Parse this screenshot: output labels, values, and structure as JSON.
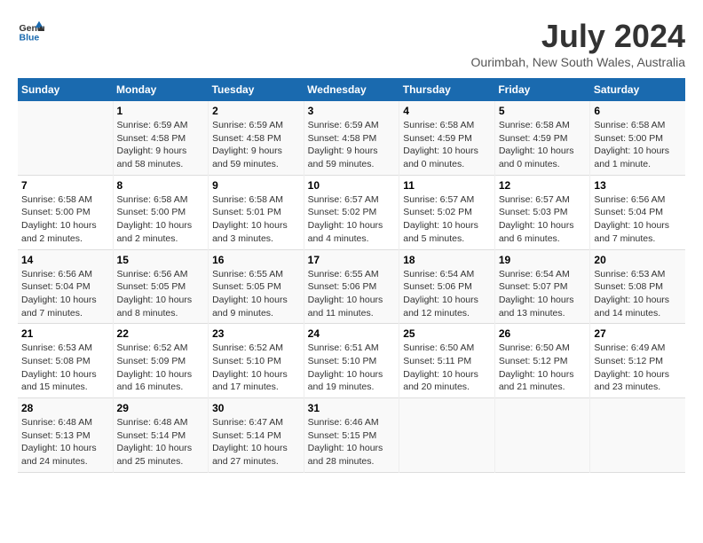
{
  "header": {
    "logo_general": "General",
    "logo_blue": "Blue",
    "title": "July 2024",
    "subtitle": "Ourimbah, New South Wales, Australia"
  },
  "columns": [
    "Sunday",
    "Monday",
    "Tuesday",
    "Wednesday",
    "Thursday",
    "Friday",
    "Saturday"
  ],
  "weeks": [
    [
      {
        "day": "",
        "info": ""
      },
      {
        "day": "1",
        "info": "Sunrise: 6:59 AM\nSunset: 4:58 PM\nDaylight: 9 hours\nand 58 minutes."
      },
      {
        "day": "2",
        "info": "Sunrise: 6:59 AM\nSunset: 4:58 PM\nDaylight: 9 hours\nand 59 minutes."
      },
      {
        "day": "3",
        "info": "Sunrise: 6:59 AM\nSunset: 4:58 PM\nDaylight: 9 hours\nand 59 minutes."
      },
      {
        "day": "4",
        "info": "Sunrise: 6:58 AM\nSunset: 4:59 PM\nDaylight: 10 hours\nand 0 minutes."
      },
      {
        "day": "5",
        "info": "Sunrise: 6:58 AM\nSunset: 4:59 PM\nDaylight: 10 hours\nand 0 minutes."
      },
      {
        "day": "6",
        "info": "Sunrise: 6:58 AM\nSunset: 5:00 PM\nDaylight: 10 hours\nand 1 minute."
      }
    ],
    [
      {
        "day": "7",
        "info": "Sunrise: 6:58 AM\nSunset: 5:00 PM\nDaylight: 10 hours\nand 2 minutes."
      },
      {
        "day": "8",
        "info": "Sunrise: 6:58 AM\nSunset: 5:00 PM\nDaylight: 10 hours\nand 2 minutes."
      },
      {
        "day": "9",
        "info": "Sunrise: 6:58 AM\nSunset: 5:01 PM\nDaylight: 10 hours\nand 3 minutes."
      },
      {
        "day": "10",
        "info": "Sunrise: 6:57 AM\nSunset: 5:02 PM\nDaylight: 10 hours\nand 4 minutes."
      },
      {
        "day": "11",
        "info": "Sunrise: 6:57 AM\nSunset: 5:02 PM\nDaylight: 10 hours\nand 5 minutes."
      },
      {
        "day": "12",
        "info": "Sunrise: 6:57 AM\nSunset: 5:03 PM\nDaylight: 10 hours\nand 6 minutes."
      },
      {
        "day": "13",
        "info": "Sunrise: 6:56 AM\nSunset: 5:04 PM\nDaylight: 10 hours\nand 7 minutes."
      }
    ],
    [
      {
        "day": "14",
        "info": "Sunrise: 6:56 AM\nSunset: 5:04 PM\nDaylight: 10 hours\nand 7 minutes."
      },
      {
        "day": "15",
        "info": "Sunrise: 6:56 AM\nSunset: 5:05 PM\nDaylight: 10 hours\nand 8 minutes."
      },
      {
        "day": "16",
        "info": "Sunrise: 6:55 AM\nSunset: 5:05 PM\nDaylight: 10 hours\nand 9 minutes."
      },
      {
        "day": "17",
        "info": "Sunrise: 6:55 AM\nSunset: 5:06 PM\nDaylight: 10 hours\nand 11 minutes."
      },
      {
        "day": "18",
        "info": "Sunrise: 6:54 AM\nSunset: 5:06 PM\nDaylight: 10 hours\nand 12 minutes."
      },
      {
        "day": "19",
        "info": "Sunrise: 6:54 AM\nSunset: 5:07 PM\nDaylight: 10 hours\nand 13 minutes."
      },
      {
        "day": "20",
        "info": "Sunrise: 6:53 AM\nSunset: 5:08 PM\nDaylight: 10 hours\nand 14 minutes."
      }
    ],
    [
      {
        "day": "21",
        "info": "Sunrise: 6:53 AM\nSunset: 5:08 PM\nDaylight: 10 hours\nand 15 minutes."
      },
      {
        "day": "22",
        "info": "Sunrise: 6:52 AM\nSunset: 5:09 PM\nDaylight: 10 hours\nand 16 minutes."
      },
      {
        "day": "23",
        "info": "Sunrise: 6:52 AM\nSunset: 5:10 PM\nDaylight: 10 hours\nand 17 minutes."
      },
      {
        "day": "24",
        "info": "Sunrise: 6:51 AM\nSunset: 5:10 PM\nDaylight: 10 hours\nand 19 minutes."
      },
      {
        "day": "25",
        "info": "Sunrise: 6:50 AM\nSunset: 5:11 PM\nDaylight: 10 hours\nand 20 minutes."
      },
      {
        "day": "26",
        "info": "Sunrise: 6:50 AM\nSunset: 5:12 PM\nDaylight: 10 hours\nand 21 minutes."
      },
      {
        "day": "27",
        "info": "Sunrise: 6:49 AM\nSunset: 5:12 PM\nDaylight: 10 hours\nand 23 minutes."
      }
    ],
    [
      {
        "day": "28",
        "info": "Sunrise: 6:48 AM\nSunset: 5:13 PM\nDaylight: 10 hours\nand 24 minutes."
      },
      {
        "day": "29",
        "info": "Sunrise: 6:48 AM\nSunset: 5:14 PM\nDaylight: 10 hours\nand 25 minutes."
      },
      {
        "day": "30",
        "info": "Sunrise: 6:47 AM\nSunset: 5:14 PM\nDaylight: 10 hours\nand 27 minutes."
      },
      {
        "day": "31",
        "info": "Sunrise: 6:46 AM\nSunset: 5:15 PM\nDaylight: 10 hours\nand 28 minutes."
      },
      {
        "day": "",
        "info": ""
      },
      {
        "day": "",
        "info": ""
      },
      {
        "day": "",
        "info": ""
      }
    ]
  ]
}
